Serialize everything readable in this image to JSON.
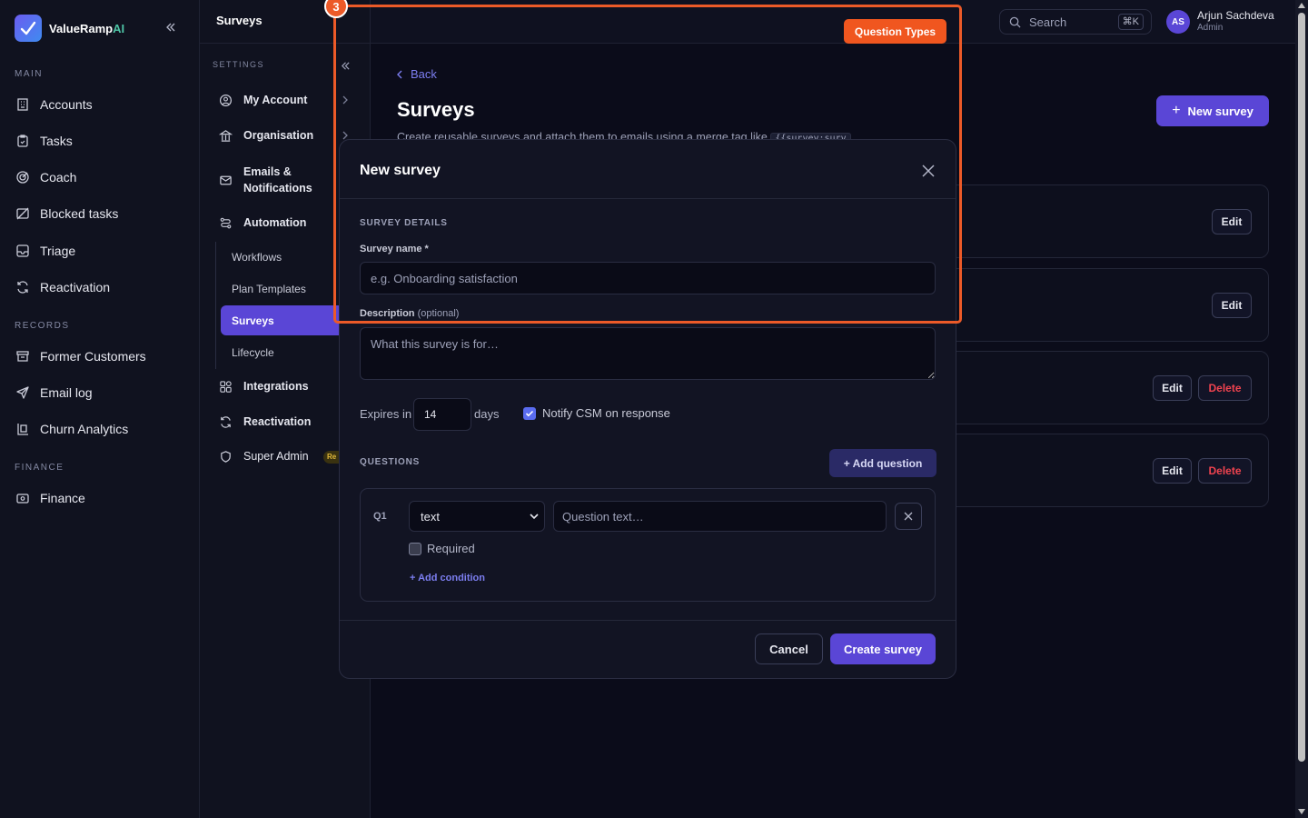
{
  "brand": {
    "name": "ValueRamp",
    "suffix": "AI"
  },
  "sidebar": {
    "sections": [
      {
        "label": "MAIN"
      },
      {
        "label": "RECORDS"
      },
      {
        "label": "FINANCE"
      }
    ],
    "items": [
      {
        "label": "Accounts",
        "icon": "building-icon"
      },
      {
        "label": "Tasks",
        "icon": "clipboard-icon"
      },
      {
        "label": "Coach",
        "icon": "target-icon"
      },
      {
        "label": "Blocked tasks",
        "icon": "blocked-icon"
      },
      {
        "label": "Triage",
        "icon": "inbox-icon"
      },
      {
        "label": "Reactivation",
        "icon": "refresh-icon"
      },
      {
        "label": "Former Customers",
        "icon": "archive-icon"
      },
      {
        "label": "Email log",
        "icon": "send-icon"
      },
      {
        "label": "Churn Analytics",
        "icon": "chart-icon"
      },
      {
        "label": "Finance",
        "icon": "wallet-icon"
      }
    ]
  },
  "settings": {
    "title": "Surveys",
    "section": "SETTINGS",
    "items": [
      {
        "label": "My Account"
      },
      {
        "label": "Organisation"
      },
      {
        "label": "Emails & Notifications"
      },
      {
        "label": "Automation"
      },
      {
        "label": "Integrations"
      },
      {
        "label": "Reactivation"
      },
      {
        "label": "Super Admin"
      }
    ],
    "sub_items": [
      "Workflows",
      "Plan Templates",
      "Surveys",
      "Lifecycle"
    ],
    "badge": "Re"
  },
  "topbar": {
    "search_placeholder": "Search",
    "shortcut": "⌘K",
    "user": {
      "initials": "AS",
      "name": "Arjun Sachdeva",
      "role": "Admin"
    }
  },
  "main": {
    "back": "Back",
    "title": "Surveys",
    "description": "Create reusable surveys and attach them to emails using a merge tag like",
    "merge_tag": "{{survey:surv",
    "new_button": "New survey",
    "edit": "Edit",
    "delete": "Delete"
  },
  "modal": {
    "title": "New survey",
    "section_details": "SURVEY DETAILS",
    "name_label": "Survey name *",
    "name_placeholder": "e.g. Onboarding satisfaction",
    "desc_label": "Description",
    "desc_optional": "(optional)",
    "desc_placeholder": "What this survey is for…",
    "expires_label": "Expires in",
    "expires_value": "14",
    "days": "days",
    "notify_label": "Notify CSM on response",
    "notify_checked": true,
    "section_questions": "QUESTIONS",
    "add_question": "+ Add question",
    "question": {
      "number": "Q1",
      "type": "text",
      "placeholder": "Question text…",
      "required_label": "Required",
      "required_checked": false,
      "add_condition": "+ Add condition"
    },
    "cancel": "Cancel",
    "create": "Create survey"
  },
  "annotation": {
    "number": "3",
    "tag": "Question Types",
    "color": "#ec5a28"
  }
}
